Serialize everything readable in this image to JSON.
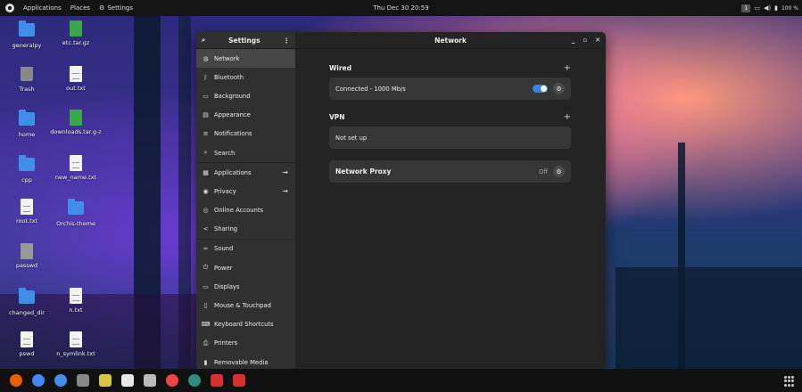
{
  "topbar": {
    "applications": "Applications",
    "places": "Places",
    "settings": "Settings",
    "datetime": "Thu Dec 30  20:59",
    "workspace": "1",
    "battery": "100 %"
  },
  "desktop": {
    "icons": [
      {
        "label": "generalpy",
        "type": "folder"
      },
      {
        "label": "etc.tar.gz",
        "type": "archive"
      },
      {
        "label": "Trash",
        "type": "trash"
      },
      {
        "label": "out.txt",
        "type": "text"
      },
      {
        "label": "home",
        "type": "folder"
      },
      {
        "label": "downloads.tar.g-z",
        "type": "archive"
      },
      {
        "label": "cpp",
        "type": "folder"
      },
      {
        "label": "new_name.txt",
        "type": "text"
      },
      {
        "label": "root.txt",
        "type": "text"
      },
      {
        "label": "Orchis-theme",
        "type": "folder"
      },
      {
        "label": "passwd",
        "type": "unknown"
      },
      {
        "label": "changed_dir",
        "type": "folder"
      },
      {
        "label": "n.txt",
        "type": "text"
      },
      {
        "label": "pswd",
        "type": "text"
      },
      {
        "label": "n_symlink.txt",
        "type": "text"
      }
    ]
  },
  "settings": {
    "sidebar_title": "Settings",
    "items": [
      {
        "label": "Network",
        "icon": "globe-icon"
      },
      {
        "label": "Bluetooth",
        "icon": "bluetooth-icon"
      },
      {
        "label": "Background",
        "icon": "monitor-icon"
      },
      {
        "label": "Appearance",
        "icon": "appearance-icon"
      },
      {
        "label": "Notifications",
        "icon": "bell-icon"
      },
      {
        "label": "Search",
        "icon": "search-icon"
      },
      {
        "label": "Applications",
        "icon": "apps-icon"
      },
      {
        "label": "Privacy",
        "icon": "privacy-icon"
      },
      {
        "label": "Online Accounts",
        "icon": "cloud-icon"
      },
      {
        "label": "Sharing",
        "icon": "share-icon"
      },
      {
        "label": "Sound",
        "icon": "sound-icon"
      },
      {
        "label": "Power",
        "icon": "power-icon"
      },
      {
        "label": "Displays",
        "icon": "display-icon"
      },
      {
        "label": "Mouse & Touchpad",
        "icon": "mouse-icon"
      },
      {
        "label": "Keyboard Shortcuts",
        "icon": "keyboard-icon"
      },
      {
        "label": "Printers",
        "icon": "printer-icon"
      },
      {
        "label": "Removable Media",
        "icon": "usb-icon"
      }
    ],
    "panel_title": "Network",
    "wired": {
      "title": "Wired",
      "status": "Connected - 1000 Mb/s"
    },
    "vpn": {
      "title": "VPN",
      "status": "Not set up"
    },
    "proxy": {
      "title": "Network Proxy",
      "status": "Off"
    }
  },
  "colors": {
    "accent": "#3584e4",
    "sidebar_bg": "#303030",
    "window_bg": "#242424",
    "card_bg": "#363636"
  }
}
